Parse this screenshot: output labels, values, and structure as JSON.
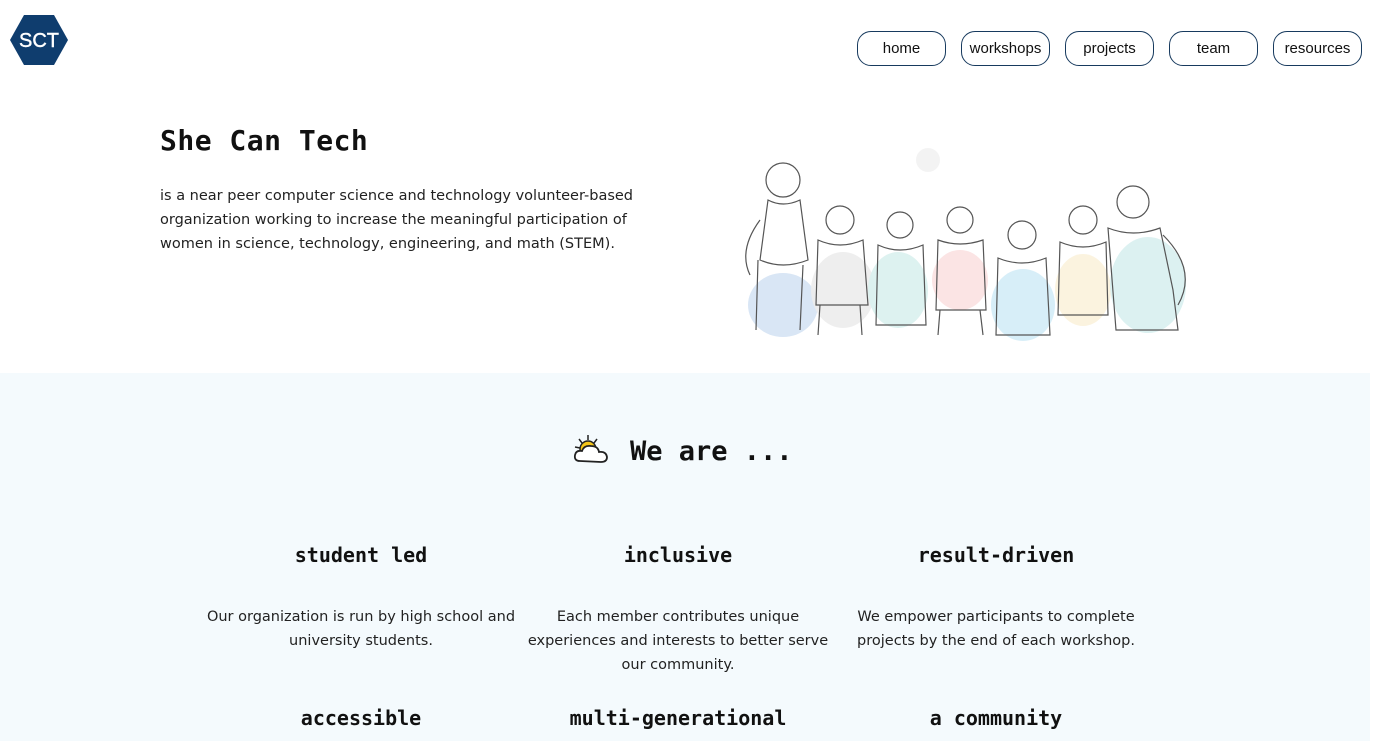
{
  "brand": {
    "logo_text": "SCT",
    "color": "#0f3d6e"
  },
  "nav": {
    "items": [
      {
        "label": "home"
      },
      {
        "label": "workshops"
      },
      {
        "label": "projects"
      },
      {
        "label": "team"
      },
      {
        "label": "resources"
      }
    ]
  },
  "hero": {
    "title": "She Can Tech",
    "description": "is a near peer computer science and technology volunteer-based organization working to increase the meaningful participation of women in science, technology, engineering, and math (STEM).",
    "illustration_icon": "group-of-women-illustration"
  },
  "we_are": {
    "icon": "sun-behind-cloud-icon",
    "title": "We are ...",
    "features": [
      {
        "title": "student led",
        "desc": "Our organization is run by high school and university students."
      },
      {
        "title": "inclusive",
        "desc": "Each member contributes unique experiences and interests to better serve our community."
      },
      {
        "title": "result-driven",
        "desc": "We empower participants to complete projects by the end of each workshop."
      },
      {
        "title": "accessible",
        "desc": ""
      },
      {
        "title": "multi-generational",
        "desc": ""
      },
      {
        "title": "a community",
        "desc": ""
      }
    ]
  },
  "colors": {
    "section_bg": "#f4fafd",
    "nav_border": "#173a5e"
  }
}
